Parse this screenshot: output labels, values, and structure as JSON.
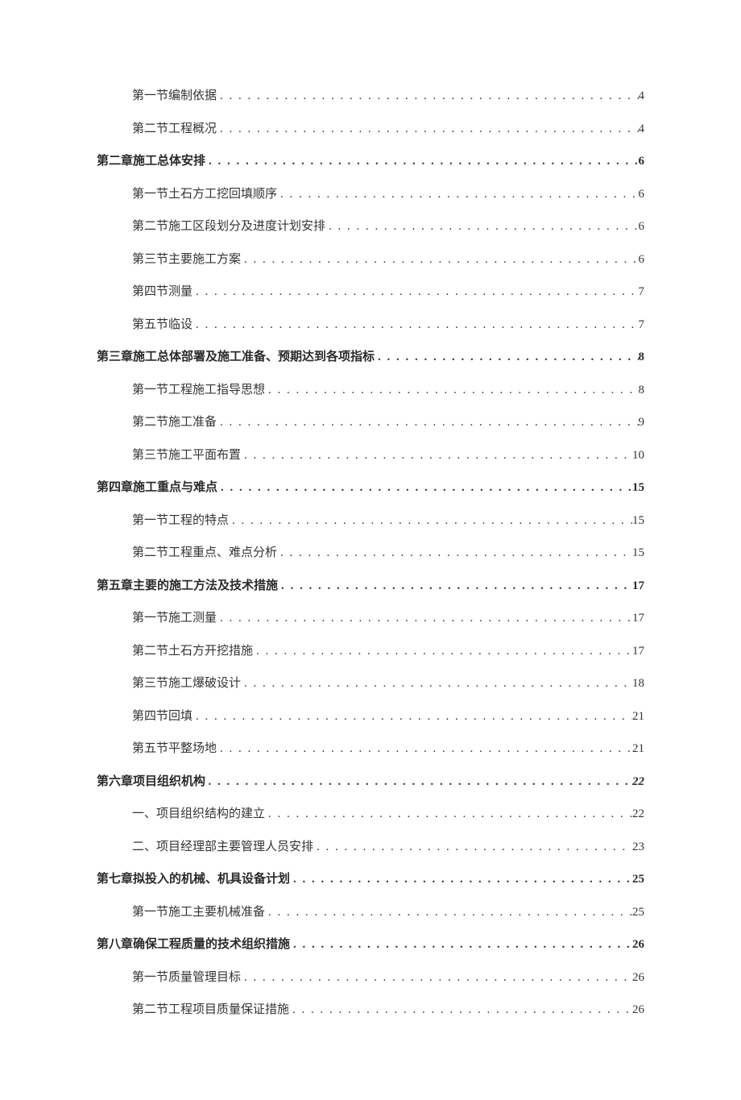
{
  "toc": [
    {
      "level": 2,
      "title": "第一节编制依据",
      "page": "4",
      "italic": false
    },
    {
      "level": 2,
      "title": "第二节工程概况",
      "page": "4",
      "italic": false
    },
    {
      "level": 1,
      "title": "第二章施工总体安排",
      "page": "6",
      "italic": false
    },
    {
      "level": 2,
      "title": "第一节土石方工挖回填顺序",
      "page": "6",
      "italic": false
    },
    {
      "level": 2,
      "title": "第二节施工区段划分及进度计划安排",
      "page": "6",
      "italic": false
    },
    {
      "level": 2,
      "title": "第三节主要施工方案",
      "page": "6",
      "italic": false
    },
    {
      "level": 2,
      "title": "第四节测量",
      "page": "7",
      "italic": false
    },
    {
      "level": 2,
      "title": "第五节临设",
      "page": "7",
      "italic": false
    },
    {
      "level": 1,
      "title": "第三章施工总体部署及施工准备、预期达到各项指标",
      "page": "8",
      "italic": false
    },
    {
      "level": 2,
      "title": "第一节工程施工指导思想",
      "page": "8",
      "italic": false
    },
    {
      "level": 2,
      "title": "第二节施工准备",
      "page": "9",
      "italic": false
    },
    {
      "level": 2,
      "title": "第三节施工平面布置",
      "page": "10",
      "italic": false
    },
    {
      "level": 1,
      "title": "第四章施工重点与难点",
      "page": "15",
      "italic": false
    },
    {
      "level": 2,
      "title": "第一节工程的特点",
      "page": "15",
      "italic": false
    },
    {
      "level": 2,
      "title": "第二节工程重点、难点分析",
      "page": "15",
      "italic": false
    },
    {
      "level": 1,
      "title": "第五章主要的施工方法及技术措施",
      "page": "17",
      "italic": false
    },
    {
      "level": 2,
      "title": "第一节施工测量",
      "page": "17",
      "italic": false
    },
    {
      "level": 2,
      "title": "第二节土石方开挖措施",
      "page": "17",
      "italic": false
    },
    {
      "level": 2,
      "title": "第三节施工爆破设计",
      "page": "18",
      "italic": false
    },
    {
      "level": 2,
      "title": "第四节回填",
      "page": "21",
      "italic": false
    },
    {
      "level": 2,
      "title": "第五节平整场地",
      "page": "21",
      "italic": false
    },
    {
      "level": 1,
      "title": "第六章项目组织机构",
      "page": "22",
      "italic": true
    },
    {
      "level": 2,
      "title": "一、项目组织结构的建立",
      "page": "22",
      "italic": false
    },
    {
      "level": 2,
      "title": "二、项目经理部主要管理人员安排",
      "page": "23",
      "italic": false
    },
    {
      "level": 1,
      "title": "第七章拟投入的机械、机具设备计划",
      "page": "25",
      "italic": false
    },
    {
      "level": 2,
      "title": "第一节施工主要机械准备",
      "page": "25",
      "italic": false
    },
    {
      "level": 1,
      "title": "第八章确保工程质量的技术组织措施",
      "page": "26",
      "italic": false
    },
    {
      "level": 2,
      "title": "第一节质量管理目标",
      "page": "26",
      "italic": false
    },
    {
      "level": 2,
      "title": "第二节工程项目质量保证措施",
      "page": "26",
      "italic": false
    }
  ]
}
